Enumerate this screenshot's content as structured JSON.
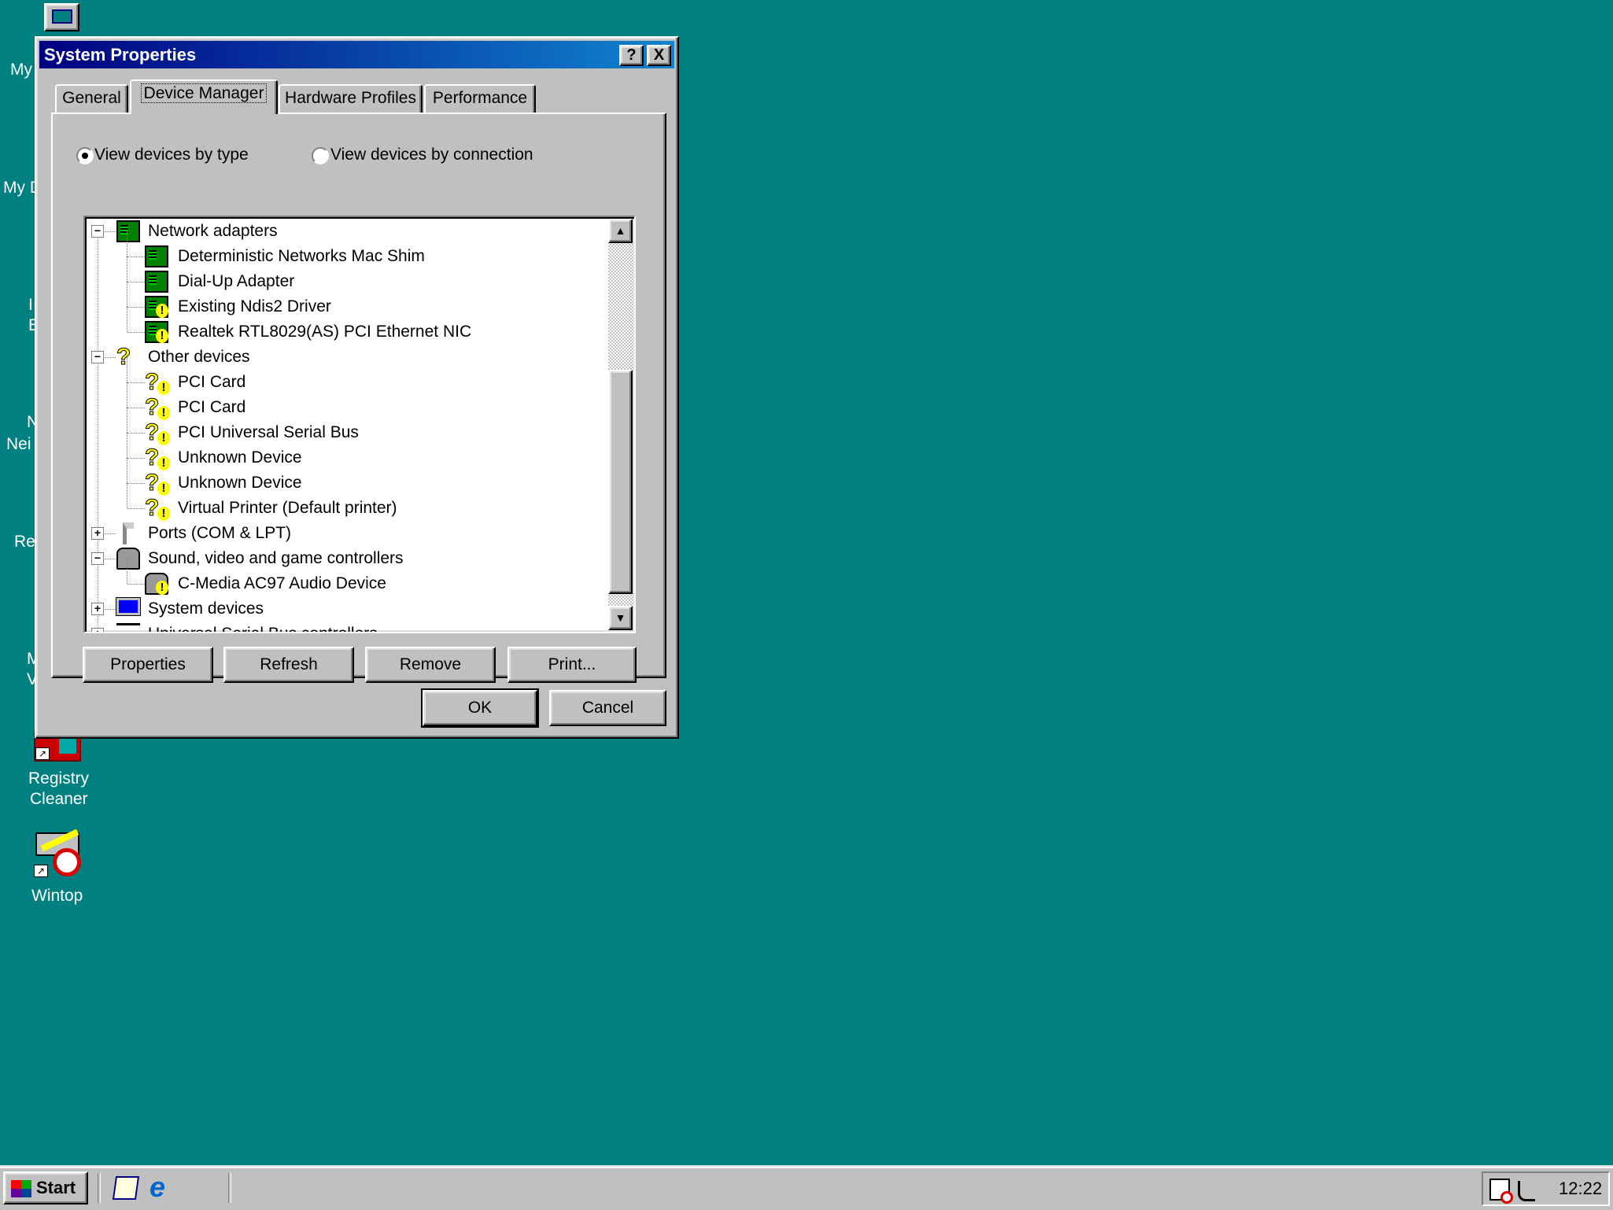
{
  "desktop": {
    "icons": [
      {
        "label": "My"
      },
      {
        "label": "My D"
      },
      {
        "label_line1": "I",
        "label_line2": "E"
      },
      {
        "label_line1": "N",
        "label_line2": "Nei"
      },
      {
        "label": "Re"
      },
      {
        "label_line1": "M",
        "label_line2": "V"
      },
      {
        "label_line1": "Registry",
        "label_line2": "Cleaner"
      },
      {
        "label": "Wintop"
      }
    ]
  },
  "dialog": {
    "title": "System Properties",
    "help_label": "?",
    "close_label": "X",
    "tabs": [
      {
        "label": "General"
      },
      {
        "label": "Device Manager",
        "active": true
      },
      {
        "label": "Hardware Profiles"
      },
      {
        "label": "Performance"
      }
    ],
    "view_by_type": "View devices by type",
    "view_by_connection": "View devices by connection",
    "selected_view": "type",
    "tree": [
      {
        "label": "Network adapters",
        "level": 0,
        "expander": "-",
        "icon": "network-adapter-icon"
      },
      {
        "label": "Deterministic Networks Mac Shim",
        "level": 1,
        "icon": "network-adapter-icon"
      },
      {
        "label": "Dial-Up Adapter",
        "level": 1,
        "icon": "network-adapter-icon"
      },
      {
        "label": "Existing Ndis2 Driver",
        "level": 1,
        "icon": "network-adapter-warning-icon"
      },
      {
        "label": "Realtek RTL8029(AS) PCI Ethernet NIC",
        "level": 1,
        "icon": "network-adapter-warning-icon"
      },
      {
        "label": "Other devices",
        "level": 0,
        "expander": "-",
        "icon": "question-icon"
      },
      {
        "label": "PCI Card",
        "level": 1,
        "icon": "question-warning-icon"
      },
      {
        "label": "PCI Card",
        "level": 1,
        "icon": "question-warning-icon"
      },
      {
        "label": "PCI Universal Serial Bus",
        "level": 1,
        "icon": "question-warning-icon"
      },
      {
        "label": "Unknown Device",
        "level": 1,
        "icon": "question-warning-icon"
      },
      {
        "label": "Unknown Device",
        "level": 1,
        "icon": "question-warning-icon"
      },
      {
        "label": "Virtual Printer (Default printer)",
        "level": 1,
        "icon": "question-warning-icon"
      },
      {
        "label": "Ports (COM & LPT)",
        "level": 0,
        "expander": "+",
        "icon": "port-icon"
      },
      {
        "label": "Sound, video and game controllers",
        "level": 0,
        "expander": "-",
        "icon": "sound-icon"
      },
      {
        "label": "C-Media AC97 Audio Device",
        "level": 1,
        "icon": "sound-warning-icon"
      },
      {
        "label": "System devices",
        "level": 0,
        "expander": "+",
        "icon": "computer-icon"
      },
      {
        "label": "Universal Serial Bus controllers",
        "level": 0,
        "expander": "+",
        "icon": "usb-icon"
      }
    ],
    "buttons": {
      "properties": "Properties",
      "refresh": "Refresh",
      "remove": "Remove",
      "print": "Print..."
    },
    "ok": "OK",
    "cancel": "Cancel"
  },
  "taskbar": {
    "start_label": "Start",
    "clock": "12:22"
  },
  "colors": {
    "desktop": "#008080",
    "titlebar_start": "#000080",
    "titlebar_end": "#1084d0",
    "face": "#c0c0c0"
  }
}
